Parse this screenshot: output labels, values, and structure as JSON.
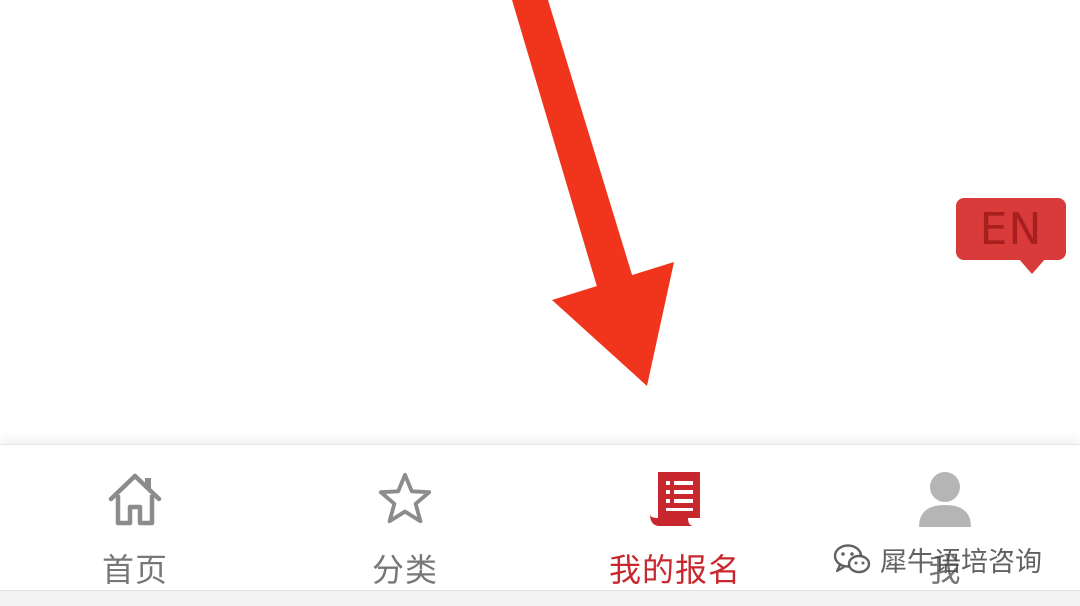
{
  "language_badge": {
    "label": "EN",
    "color": "#d93a3a"
  },
  "tabbar": {
    "active_color": "#c8282d",
    "inactive_color": "#777777",
    "tabs": [
      {
        "label": "首页",
        "icon": "home-icon",
        "active": false
      },
      {
        "label": "分类",
        "icon": "star-icon",
        "active": false
      },
      {
        "label": "我的报名",
        "icon": "document-list-icon",
        "active": true
      },
      {
        "label": "我",
        "icon": "user-icon",
        "active": false
      }
    ]
  },
  "annotation": {
    "arrow_color": "#f0351c"
  },
  "watermark": {
    "text": "犀牛语培咨询",
    "icon": "wechat-logo-icon"
  }
}
